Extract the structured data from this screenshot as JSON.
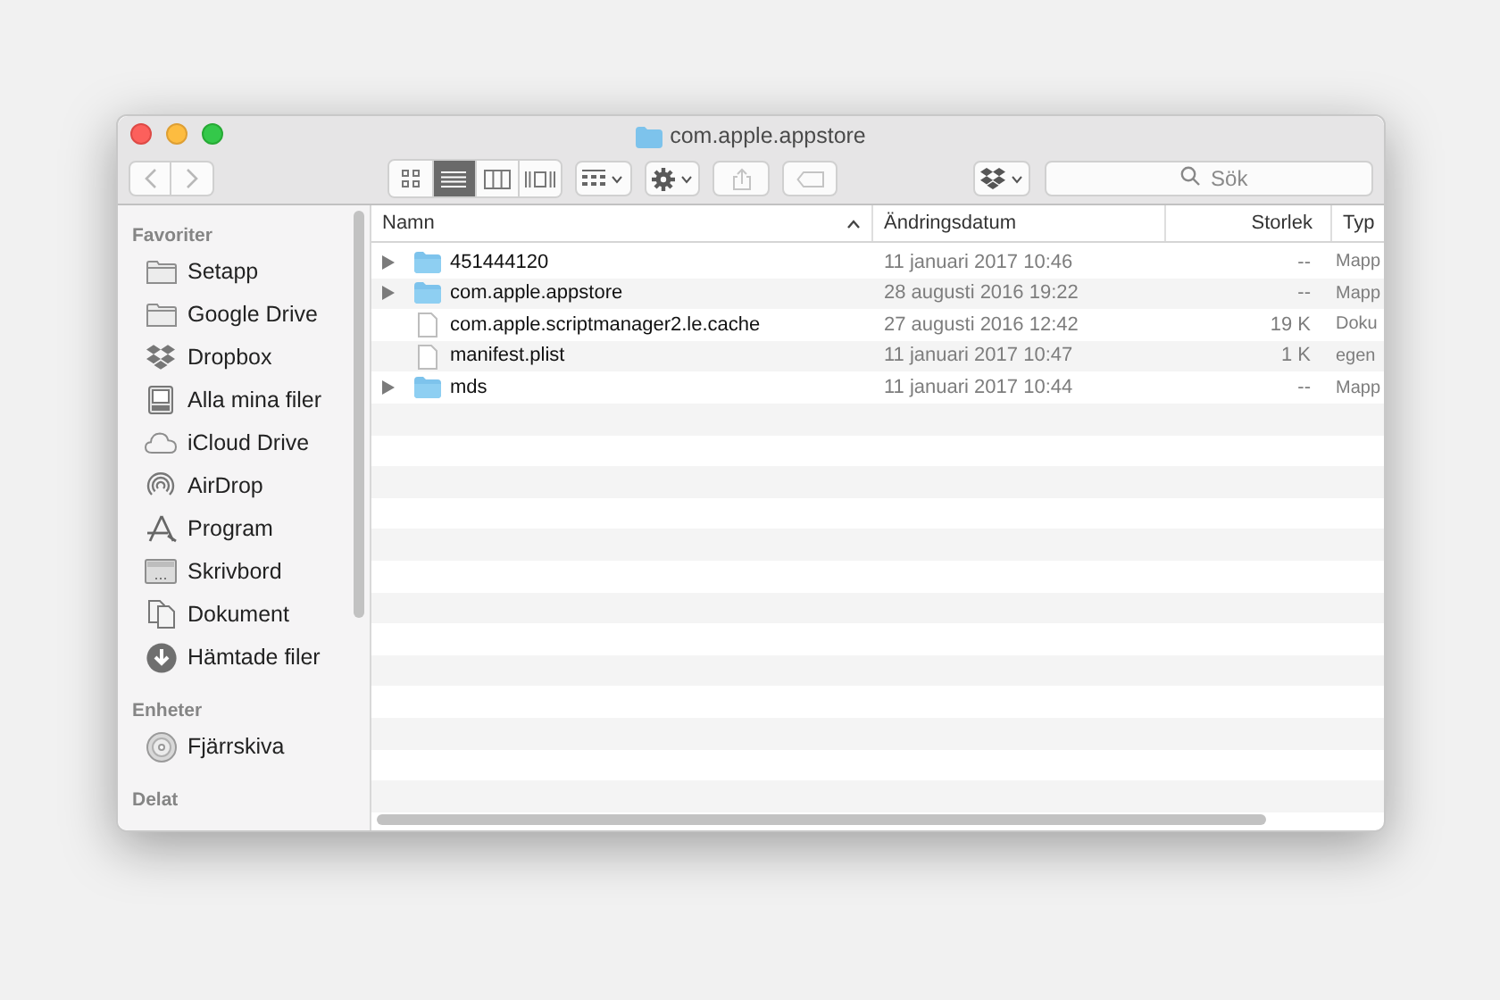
{
  "window": {
    "title": "com.apple.appstore"
  },
  "toolbar": {
    "views": [
      {
        "kind": "icons",
        "selected": false
      },
      {
        "kind": "list",
        "selected": true
      },
      {
        "kind": "columns",
        "selected": false
      },
      {
        "kind": "coverflow",
        "selected": false
      }
    ],
    "search": {
      "placeholder": "Sök"
    }
  },
  "sidebar": {
    "sections": [
      {
        "title": "Favoriter",
        "items": [
          {
            "label": "Setapp",
            "kind": "folder"
          },
          {
            "label": "Google Drive",
            "kind": "folder"
          },
          {
            "label": "Dropbox",
            "kind": "dropbox"
          },
          {
            "label": "Alla mina filer",
            "kind": "allfiles"
          },
          {
            "label": "iCloud Drive",
            "kind": "cloud"
          },
          {
            "label": "AirDrop",
            "kind": "airdrop"
          },
          {
            "label": "Program",
            "kind": "apps"
          },
          {
            "label": "Skrivbord",
            "kind": "desktop"
          },
          {
            "label": "Dokument",
            "kind": "documents"
          },
          {
            "label": "Hämtade filer",
            "kind": "downloads"
          }
        ]
      },
      {
        "title": "Enheter",
        "items": [
          {
            "label": "Fjärrskiva",
            "kind": "disc"
          }
        ]
      },
      {
        "title": "Delat"
      }
    ]
  },
  "table": {
    "columns": [
      "Namn",
      "Ändringsdatum",
      "Storlek",
      "Typ"
    ],
    "rows": [
      {
        "kind": "folder",
        "expanded": false,
        "name": "451444120",
        "date": "11 januari 2017 10:46",
        "size": "--",
        "type": "Mapp"
      },
      {
        "kind": "folder",
        "expanded": false,
        "name": "com.apple.appstore",
        "date": "28 augusti 2016 19:22",
        "size": "--",
        "type": "Mapp"
      },
      {
        "kind": "file",
        "name": "com.apple.scriptmanager2.le.cache",
        "date": "27 augusti 2016 12:42",
        "size": "19 K",
        "type": "Doku"
      },
      {
        "kind": "file",
        "name": "manifest.plist",
        "date": "11 januari 2017 10:47",
        "size": "1 K",
        "type": "egen"
      },
      {
        "kind": "folder",
        "expanded": false,
        "name": "mds",
        "date": "11 januari 2017 10:44",
        "size": "--",
        "type": "Mapp"
      }
    ]
  }
}
